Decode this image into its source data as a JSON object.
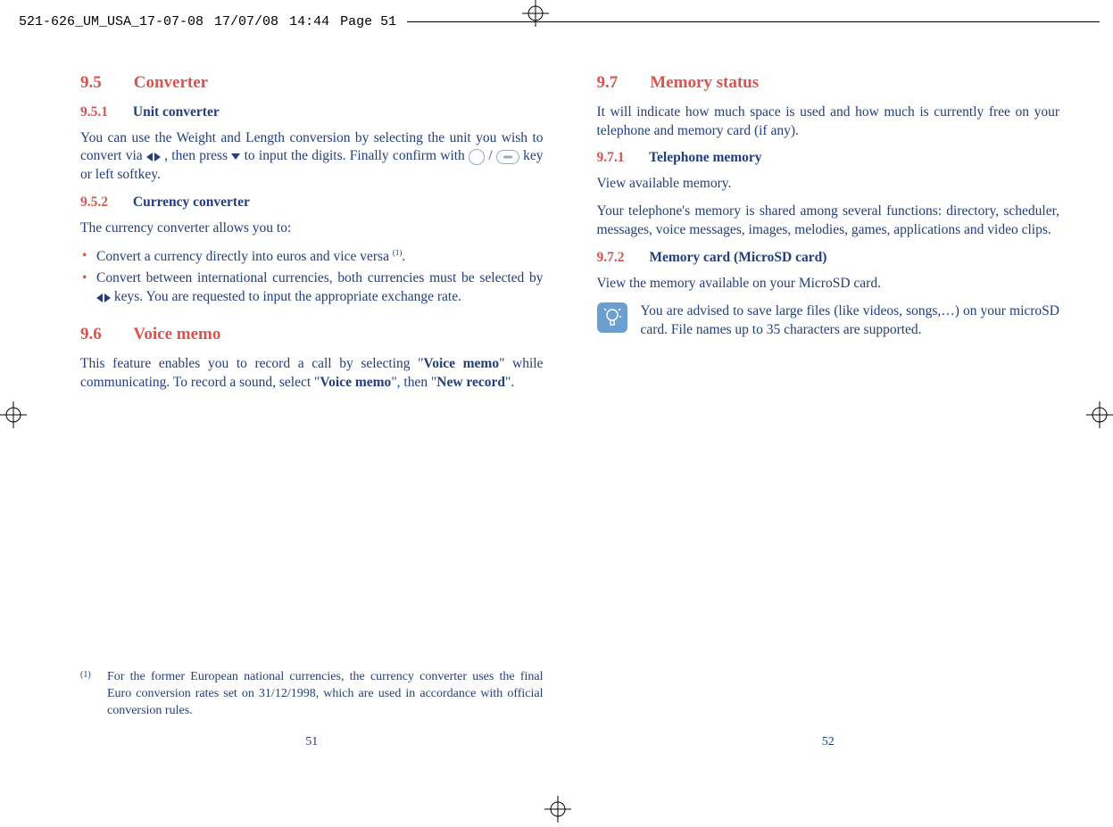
{
  "header": {
    "file": "521-626_UM_USA_17-07-08",
    "date": "17/07/08",
    "time": "14:44",
    "page": "Page 51"
  },
  "left": {
    "s95_num": "9.5",
    "s95_title": "Converter",
    "s951_num": "9.5.1",
    "s951_title": "Unit converter",
    "s951_p_a": "You can use the Weight and Length conversion by selecting the unit you wish to convert via ",
    "s951_p_b": ", then press ",
    "s951_p_c": " to input the digits. Finally confirm with ",
    "s951_p_d": " / ",
    "s951_p_e": " key or left softkey.",
    "s952_num": "9.5.2",
    "s952_title": "Currency converter",
    "s952_intro": "The currency converter allows you to:",
    "s952_b1_a": "Convert a currency directly into euros and vice versa ",
    "s952_b1_b": ".",
    "s952_b2_a": "Convert between international currencies, both currencies must be selected by ",
    "s952_b2_b": " keys. You are requested to input the appropriate exchange rate.",
    "s96_num": "9.6",
    "s96_title": "Voice memo",
    "s96_p_a": "This feature enables you to record a call by selecting \"",
    "s96_p_b": "\" while communicating. To record a sound, select \"",
    "s96_p_c": "\", then \"",
    "s96_p_d": "\".",
    "voice_memo": "Voice memo",
    "new_record": "New record",
    "footnote_mark": "(1)",
    "footnote": "For the former European national currencies, the currency converter uses the final Euro conversion rates set on 31/12/1998, which are used in accordance with official conversion rules.",
    "pagenum": "51"
  },
  "right": {
    "s97_num": "9.7",
    "s97_title": "Memory status",
    "s97_intro": "It will indicate how much space is used and how much is currently free on your telephone and memory card (if any).",
    "s971_num": "9.7.1",
    "s971_title": "Telephone memory",
    "s971_p1": "View available memory.",
    "s971_p2": "Your telephone's memory is shared among several functions: directory, scheduler, messages, voice messages, images, melodies, games, applications and video clips.",
    "s972_num": "9.7.2",
    "s972_title": "Memory card (MicroSD card)",
    "s972_p1": "View the memory available on your MicroSD card.",
    "tip": "You are advised to save large files (like videos, songs,…) on your microSD card. File names up to 35 characters are supported.",
    "pagenum": "52"
  }
}
